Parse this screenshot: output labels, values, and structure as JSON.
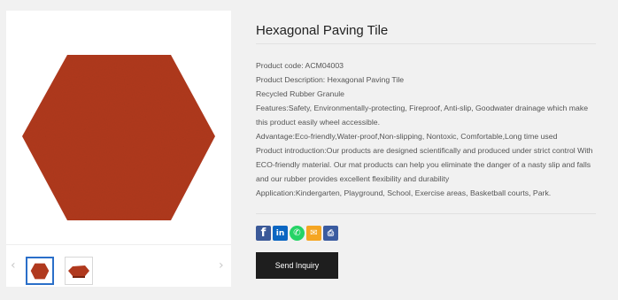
{
  "product": {
    "title": "Hexagonal Paving Tile",
    "details": [
      "Product code: ACM04003",
      "Product Description: Hexagonal Paving Tile",
      "Recycled Rubber Granule",
      "Features:Safety, Environmentally-protecting, Fireproof, Anti-slip, Goodwater drainage which make this product easily wheel accessible.",
      "Advantage:Eco-friendly,Water-proof,Non-slipping, Nontoxic, Comfortable,Long time used",
      "Product introduction:Our products are designed scientifically and produced under strict control With ECO-friendly material. Our mat products can help you eliminate the danger of a nasty slip and falls and our rubber provides excellent flexibility and durability",
      "Application:Kindergarten, Playground, School, Exercise areas, Basketball courts, Park."
    ],
    "inquiry_label": "Send Inquiry"
  },
  "gallery": {
    "prev_arrow": "‹",
    "next_arrow": "›",
    "thumbnails": [
      "hexagon-tile-thumb",
      "hexagon-tile-side-thumb"
    ],
    "tile_color": "#b0391e"
  },
  "share": {
    "icons": [
      "facebook-icon",
      "linkedin-icon",
      "whatsapp-icon",
      "email-icon",
      "print-icon"
    ],
    "facebook_glyph": "f",
    "linkedin_glyph": "in",
    "whatsapp_glyph": "✆",
    "email_glyph": "✉",
    "print_glyph": "⎙"
  },
  "colors": {
    "button_bg": "#1e1e1e",
    "page_bg": "#f1f1f1",
    "selected_thumb_border": "#2a6fc9"
  }
}
